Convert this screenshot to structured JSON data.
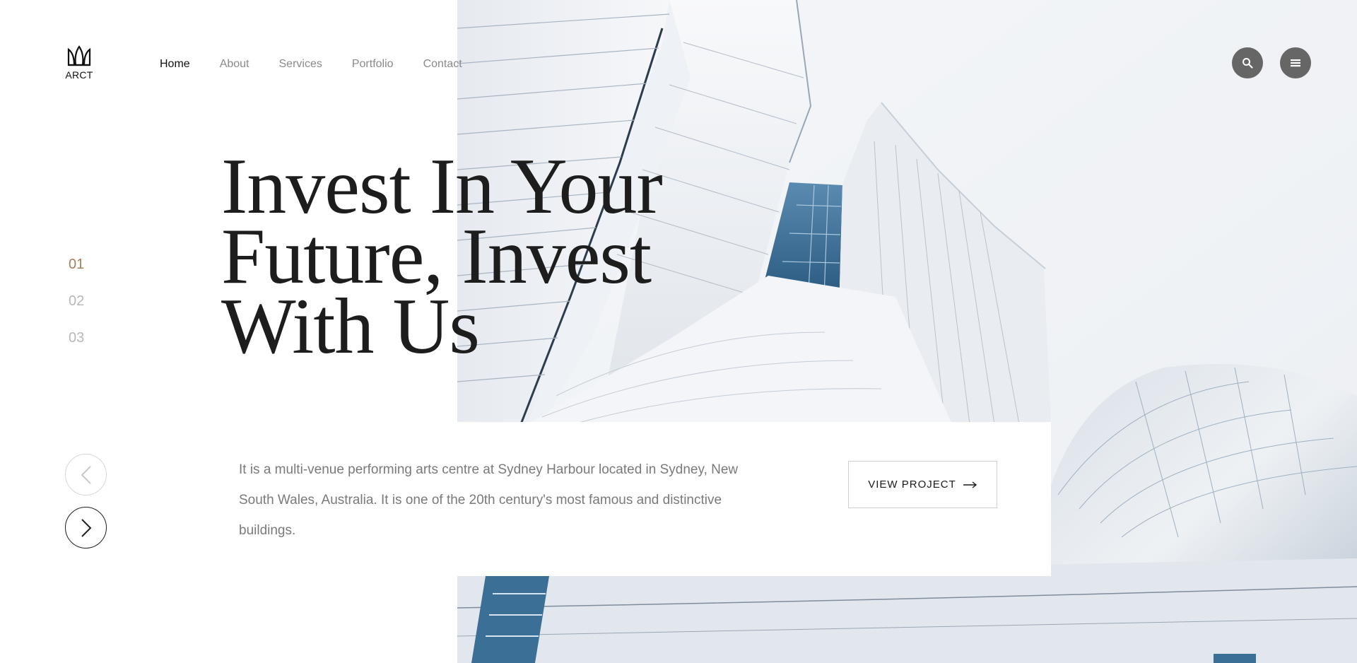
{
  "brand": {
    "logo_text": "ARCT",
    "logo_icon": "logo-leaf-icon"
  },
  "nav": {
    "items": [
      {
        "label": "Home",
        "active": true
      },
      {
        "label": "About",
        "active": false
      },
      {
        "label": "Services",
        "active": false
      },
      {
        "label": "Portfolio",
        "active": false
      },
      {
        "label": "Contact",
        "active": false
      }
    ]
  },
  "header_actions": {
    "search_icon": "search-icon",
    "menu_icon": "menu-icon"
  },
  "hero": {
    "headline_lines": [
      "Invest In Your",
      "Future, Invest",
      "With Us"
    ],
    "description": "It is a multi-venue performing arts centre at Sydney Harbour located in Sydney, New South Wales, Australia. It is one of the 20th century's most famous and distinctive buildings.",
    "cta_label": "VIEW PROJECT",
    "cta_icon": "arrow-right-icon"
  },
  "slider": {
    "numbers": [
      "01",
      "02",
      "03"
    ],
    "active_index": 0,
    "prev_icon": "chevron-left-icon",
    "next_icon": "chevron-right-icon"
  },
  "colors": {
    "accent": "#a2805d",
    "text_dark": "#1d1d1d",
    "text_muted": "#8a8a8a",
    "button_gray": "#666666"
  }
}
